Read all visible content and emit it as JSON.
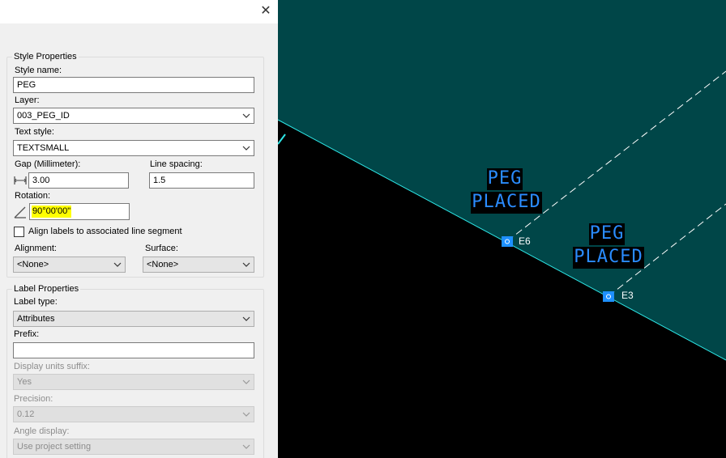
{
  "dialog": {
    "close_glyph": "✕",
    "style_properties": {
      "title": "Style Properties",
      "style_name_label": "Style name:",
      "style_name_value": "PEG",
      "layer_label": "Layer:",
      "layer_value": "003_PEG_ID",
      "text_style_label": "Text style:",
      "text_style_value": "TEXTSMALL",
      "gap_label": "Gap (Millimeter):",
      "gap_value": "3.00",
      "line_spacing_label": "Line spacing:",
      "line_spacing_value": "1.5",
      "rotation_label": "Rotation:",
      "rotation_value": "90°00'00\"",
      "align_checkbox_label": "Align labels to associated line segment",
      "align_checked": false,
      "alignment_label": "Alignment:",
      "alignment_value": "<None>",
      "surface_label": "Surface:",
      "surface_value": "<None>"
    },
    "label_properties": {
      "title": "Label Properties",
      "label_type_label": "Label type:",
      "label_type_value": "Attributes",
      "prefix_label": "Prefix:",
      "prefix_value": "",
      "display_units_suffix_label": "Display units suffix:",
      "display_units_suffix_value": "Yes",
      "precision_label": "Precision:",
      "precision_value": "0.12",
      "angle_display_label": "Angle display:",
      "angle_display_value": "Use project setting"
    }
  },
  "viewport": {
    "colors": {
      "surface_fill": "#004648",
      "background": "#000000",
      "boundary_line": "#2ee6e6",
      "peg_text": "#2a8cff",
      "marker": "#1e90ff",
      "dashed_line": "#ffffff"
    },
    "pegs": [
      {
        "point_name": "E6",
        "label_line1": "PEG",
        "label_line2": "PLACED"
      },
      {
        "point_name": "E3",
        "label_line1": "PEG",
        "label_line2": "PLACED"
      }
    ]
  }
}
